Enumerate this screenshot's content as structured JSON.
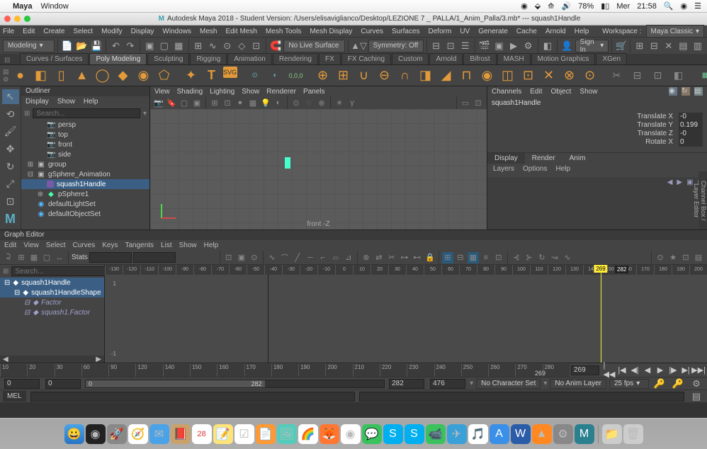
{
  "mac_menu": {
    "app": "Maya",
    "items": [
      "Window"
    ],
    "right": {
      "battery": "78%",
      "day": "Mer",
      "time": "21:58"
    }
  },
  "titlebar": {
    "maya_icon": "M",
    "title": "Autodesk Maya 2018 - Student Version: /Users/elisaviglianco/Desktop/LEZIONE 7 _ PALLA/1_Anim_Palla/3.mb*   ---   squash1Handle"
  },
  "maya_menu": [
    "File",
    "Edit",
    "Create",
    "Select",
    "Modify",
    "Display",
    "Windows",
    "Mesh",
    "Edit Mesh",
    "Mesh Tools",
    "Mesh Display",
    "Curves",
    "Surfaces",
    "Deform",
    "UV",
    "Generate",
    "Cache",
    "Arnold",
    "Help"
  ],
  "workspace_label": "Workspace :",
  "workspace_value": "Maya Classic",
  "module_dropdown": "Modeling",
  "no_live_surface": "No Live Surface",
  "symmetry": "Symmetry: Off",
  "signin": "Sign In",
  "shelf_tabs": [
    "Curves / Surfaces",
    "Poly Modeling",
    "Sculpting",
    "Rigging",
    "Animation",
    "Rendering",
    "FX",
    "FX Caching",
    "Custom",
    "Arnold",
    "Bifrost",
    "MASH",
    "Motion Graphics",
    "XGen"
  ],
  "shelf_active": 1,
  "outliner": {
    "title": "Outliner",
    "menu": [
      "Display",
      "Show",
      "Help"
    ],
    "search_placeholder": "Search...",
    "items": [
      {
        "label": "persp",
        "type": "cam",
        "indent": 1
      },
      {
        "label": "top",
        "type": "cam",
        "indent": 1
      },
      {
        "label": "front",
        "type": "cam",
        "indent": 1
      },
      {
        "label": "side",
        "type": "cam",
        "indent": 1
      },
      {
        "label": "group",
        "type": "group",
        "indent": 0,
        "toggle": "⊞"
      },
      {
        "label": "gSphere_Animation",
        "type": "group",
        "indent": 0,
        "toggle": "⊟"
      },
      {
        "label": "squash1Handle",
        "type": "deform",
        "indent": 1,
        "toggle": "",
        "selected": true
      },
      {
        "label": "pSphere1",
        "type": "mesh",
        "indent": 1,
        "toggle": "⊕"
      },
      {
        "label": "defaultLightSet",
        "type": "light",
        "indent": 0
      },
      {
        "label": "defaultObjectSet",
        "type": "light",
        "indent": 0
      }
    ]
  },
  "viewport": {
    "menu": [
      "View",
      "Shading",
      "Lighting",
      "Show",
      "Renderer",
      "Panels"
    ],
    "camera_label": "front -Z"
  },
  "channel_box": {
    "menu": [
      "Channels",
      "Edit",
      "Object",
      "Show"
    ],
    "node": "squash1Handle",
    "attrs": [
      {
        "label": "Translate X",
        "value": "-0"
      },
      {
        "label": "Translate Y",
        "value": "0.199"
      },
      {
        "label": "Translate Z",
        "value": "-0"
      },
      {
        "label": "Rotate X",
        "value": "0"
      }
    ],
    "tabs": [
      "Display",
      "Render",
      "Anim"
    ],
    "subtabs": [
      "Layers",
      "Options",
      "Help"
    ],
    "side_label": "Channel Box / Layer Editor"
  },
  "graph_editor": {
    "title": "Graph Editor",
    "menu": [
      "Edit",
      "View",
      "Select",
      "Curves",
      "Keys",
      "Tangents",
      "List",
      "Show",
      "Help"
    ],
    "search_placeholder": "Search...",
    "stats_label": "Stats",
    "outliner": [
      {
        "label": "squash1Handle",
        "selected": true,
        "indent": 0
      },
      {
        "label": "squash1HandleShape",
        "selected": true,
        "indent": 1
      },
      {
        "label": "Factor",
        "selected": false,
        "indent": 2
      },
      {
        "label": "squash1.Factor",
        "selected": false,
        "indent": 2
      }
    ],
    "ruler_start": -130,
    "ruler_step": 10,
    "ruler_count": 42,
    "y_ticks": [
      "1",
      "-1"
    ],
    "current_time": "269",
    "end_time": "282",
    "start_frame": 0
  },
  "timeline": {
    "ticks": [
      10,
      20,
      30,
      60,
      90,
      120,
      140,
      150,
      160,
      170,
      180,
      190,
      200,
      210,
      220,
      230,
      240,
      250,
      260,
      270,
      280
    ],
    "current": "269",
    "current_box": "269"
  },
  "range": {
    "start": "0",
    "range_start": "0",
    "slider_start": "0",
    "slider_end": "282",
    "range_end": "282",
    "end": "476",
    "charset": "No Character Set",
    "animlayer": "No Anim Layer",
    "fps": "25 fps"
  },
  "cmd": {
    "label": "MEL"
  },
  "dock_apps": [
    "finder",
    "safari",
    "launchpad",
    "compass",
    "cal",
    "notes",
    "pages",
    "reminders",
    "preview",
    "photos",
    "firefox",
    "chrome",
    "messages",
    "skype",
    "s2",
    "spotify",
    "discord",
    "itunes",
    "appstore",
    "activity",
    "vlc",
    "settings",
    "maya",
    "trash"
  ]
}
